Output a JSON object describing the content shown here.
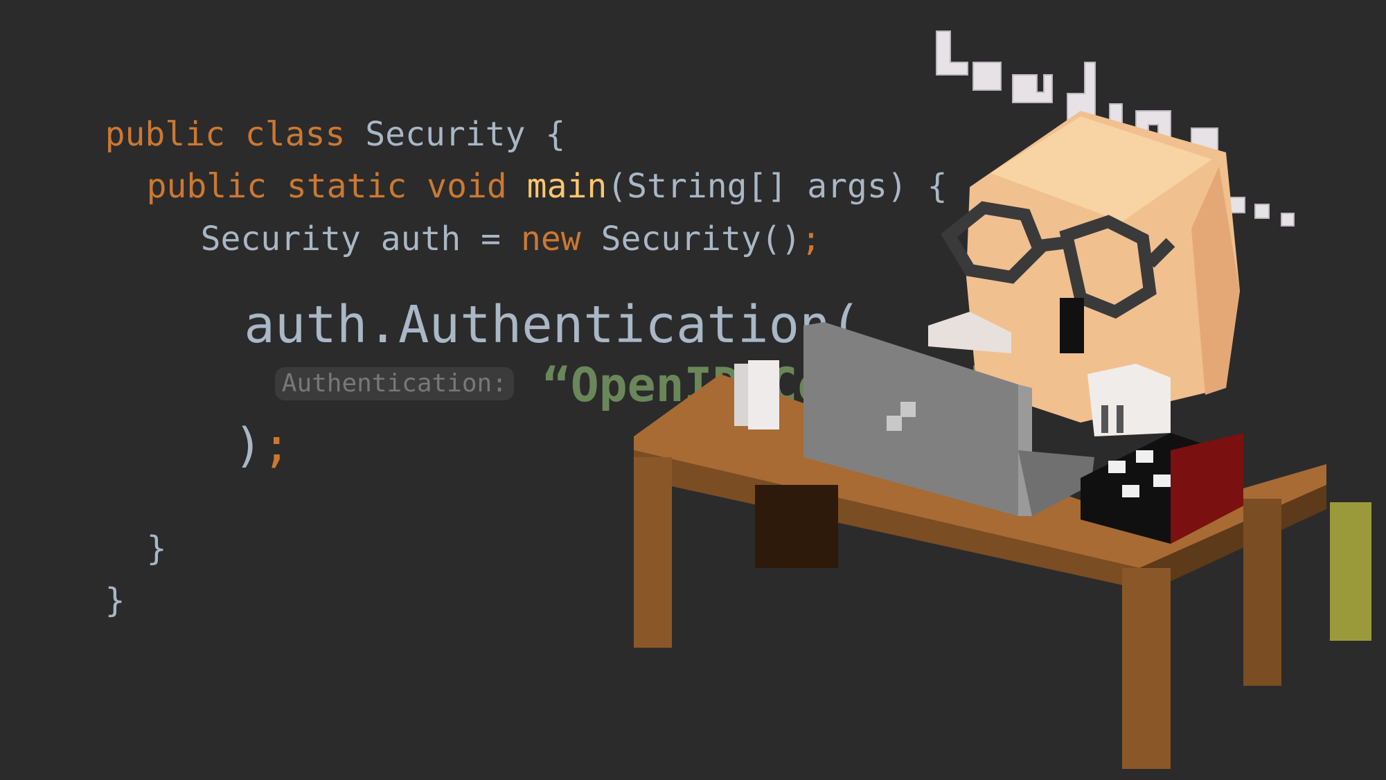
{
  "code": {
    "lines": [
      {
        "tokens": [
          {
            "t": "public class ",
            "k": "kw"
          },
          {
            "t": "Security {",
            "k": "tx"
          }
        ]
      },
      {
        "tokens": [
          {
            "t": "public static void ",
            "k": "kw"
          },
          {
            "t": "main",
            "k": "fn"
          },
          {
            "t": "(String[] args) {",
            "k": "tx"
          }
        ]
      },
      {
        "tokens": [
          {
            "t": "Security auth = ",
            "k": "tx"
          },
          {
            "t": "new ",
            "k": "kw"
          },
          {
            "t": "Security()",
            "k": "tx"
          },
          {
            "t": ";",
            "k": "semi"
          }
        ]
      },
      {
        "tokens": [
          {
            "t": "auth.Authentication(",
            "k": "tx"
          }
        ]
      },
      {
        "hint": "Authentication:",
        "tokens": [
          {
            "t": "“OpenID Connect”",
            "k": "str"
          }
        ]
      },
      {
        "tokens": [
          {
            "t": ")",
            "k": "tx"
          },
          {
            "t": ";",
            "k": "semi"
          }
        ]
      },
      {
        "tokens": [
          {
            "t": "}",
            "k": "tx"
          }
        ]
      },
      {
        "tokens": [
          {
            "t": "}",
            "k": "tx"
          }
        ]
      }
    ]
  },
  "illustration": {
    "loading_text": "Loading...",
    "subject": "voxel character with glasses at a desk with laptop, mug and books"
  },
  "colors": {
    "background": "#2b2b2b",
    "keyword": "#cc7832",
    "function": "#ffc66d",
    "text": "#a9b7c6",
    "string": "#6a8759",
    "hint_bg": "#3b3b3b",
    "hint_text": "#787878"
  }
}
